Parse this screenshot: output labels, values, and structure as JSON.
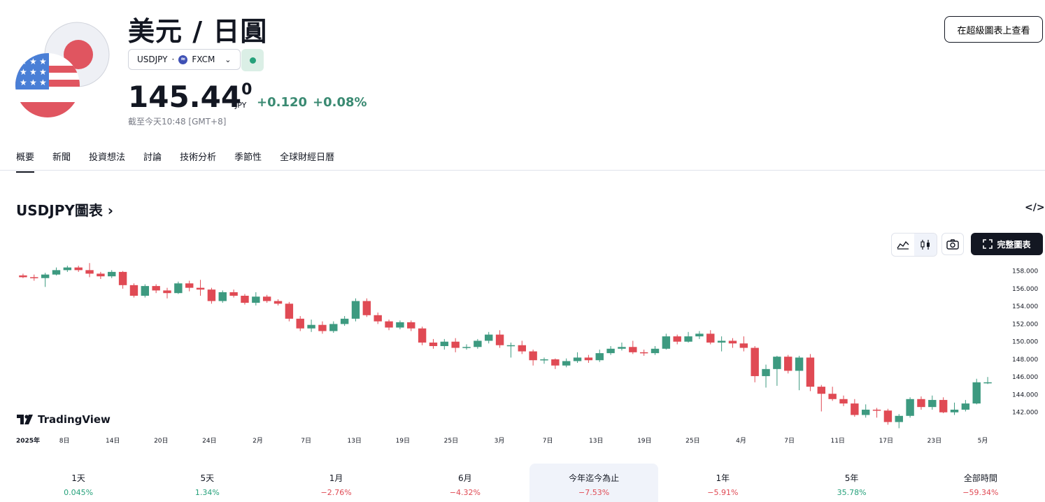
{
  "header": {
    "title": "美元 / 日圓",
    "symbol": "USDJPY",
    "separator": "·",
    "exchange": "FXCM",
    "price_main": "145.44",
    "price_sup": "0",
    "currency": "JPY",
    "change_abs": "+0.120",
    "change_pct": "+0.08%",
    "as_of": "截至今天10:48 [GMT+8]",
    "super_chart_button": "在超級圖表上查看",
    "status_color": "#26a17b"
  },
  "tabs": [
    "概要",
    "新聞",
    "投資想法",
    "討論",
    "技術分析",
    "季節性",
    "全球財經日曆"
  ],
  "chart_section": {
    "title": "USDJPY圖表",
    "full_chart_label": "完整圖表",
    "brand": "TradingView"
  },
  "chart_data": {
    "type": "candlestick",
    "up_color": "#3d9a80",
    "down_color": "#e04a54",
    "ylim": [
      140,
      159
    ],
    "y_ticks": [
      "158.000",
      "156.000",
      "154.000",
      "152.000",
      "150.000",
      "148.000",
      "146.000",
      "144.000",
      "142.000"
    ],
    "x_ticks": [
      "2025年",
      "8日",
      "14日",
      "20日",
      "24日",
      "2月",
      "7日",
      "13日",
      "19日",
      "25日",
      "3月",
      "7日",
      "13日",
      "19日",
      "25日",
      "4月",
      "7日",
      "11日",
      "17日",
      "23日",
      "5月"
    ],
    "candles": [
      [
        157.5,
        157.3,
        157.7,
        157.2
      ],
      [
        157.3,
        157.2,
        157.6,
        156.9
      ],
      [
        157.2,
        157.6,
        157.8,
        156.2
      ],
      [
        157.6,
        158.1,
        158.4,
        157.5
      ],
      [
        158.1,
        158.4,
        158.6,
        157.9
      ],
      [
        158.4,
        158.1,
        158.6,
        157.9
      ],
      [
        158.1,
        157.7,
        158.9,
        157.3
      ],
      [
        157.7,
        157.4,
        157.9,
        157.1
      ],
      [
        157.4,
        157.9,
        158.1,
        157.2
      ],
      [
        157.9,
        156.4,
        158.0,
        156.0
      ],
      [
        156.4,
        155.2,
        156.6,
        155.0
      ],
      [
        155.2,
        156.3,
        156.5,
        155.0
      ],
      [
        156.3,
        155.8,
        156.5,
        155.5
      ],
      [
        155.8,
        155.5,
        156.1,
        154.9
      ],
      [
        155.5,
        156.6,
        156.8,
        155.4
      ],
      [
        156.6,
        156.1,
        156.9,
        155.7
      ],
      [
        156.1,
        155.9,
        157.0,
        155.2
      ],
      [
        155.9,
        154.6,
        156.1,
        154.3
      ],
      [
        154.6,
        155.6,
        155.8,
        154.4
      ],
      [
        155.6,
        155.2,
        155.9,
        155.0
      ],
      [
        155.2,
        154.4,
        155.4,
        154.2
      ],
      [
        154.4,
        155.1,
        155.6,
        154.1
      ],
      [
        155.1,
        154.6,
        155.3,
        154.4
      ],
      [
        154.6,
        154.3,
        154.8,
        154.1
      ],
      [
        154.3,
        152.6,
        154.5,
        152.3
      ],
      [
        152.6,
        151.5,
        152.9,
        151.2
      ],
      [
        151.5,
        151.9,
        152.5,
        151.1
      ],
      [
        151.9,
        151.2,
        152.3,
        150.9
      ],
      [
        151.2,
        152.0,
        152.3,
        151.0
      ],
      [
        152.0,
        152.6,
        152.9,
        151.8
      ],
      [
        152.6,
        154.6,
        154.9,
        152.3
      ],
      [
        154.6,
        153.0,
        154.9,
        152.8
      ],
      [
        153.0,
        152.3,
        153.3,
        152.0
      ],
      [
        152.3,
        151.6,
        152.5,
        151.3
      ],
      [
        151.6,
        152.2,
        152.4,
        151.4
      ],
      [
        152.2,
        151.5,
        152.4,
        151.2
      ],
      [
        151.5,
        149.9,
        151.7,
        149.6
      ],
      [
        149.9,
        149.5,
        150.3,
        149.2
      ],
      [
        149.5,
        150.0,
        150.3,
        149.1
      ],
      [
        150.0,
        149.3,
        150.4,
        148.8
      ],
      [
        149.3,
        149.4,
        149.7,
        149.1
      ],
      [
        149.4,
        150.1,
        150.3,
        149.2
      ],
      [
        150.1,
        150.8,
        151.1,
        149.8
      ],
      [
        150.8,
        149.6,
        151.3,
        149.3
      ],
      [
        149.6,
        149.6,
        149.9,
        148.2
      ],
      [
        149.6,
        148.9,
        150.1,
        148.6
      ],
      [
        148.9,
        147.9,
        149.1,
        147.3
      ],
      [
        147.9,
        148.0,
        148.2,
        147.5
      ],
      [
        148.0,
        147.3,
        148.1,
        146.9
      ],
      [
        147.3,
        147.8,
        148.1,
        147.1
      ],
      [
        147.8,
        148.2,
        148.8,
        147.6
      ],
      [
        148.2,
        147.9,
        148.5,
        147.6
      ],
      [
        147.9,
        148.7,
        149.1,
        147.7
      ],
      [
        148.7,
        149.2,
        149.5,
        148.5
      ],
      [
        149.2,
        149.4,
        149.9,
        149.0
      ],
      [
        149.4,
        148.8,
        150.1,
        148.6
      ],
      [
        148.8,
        148.7,
        149.1,
        148.4
      ],
      [
        148.7,
        149.2,
        149.5,
        148.5
      ],
      [
        149.2,
        150.6,
        150.9,
        149.1
      ],
      [
        150.6,
        150.0,
        150.8,
        149.7
      ],
      [
        150.0,
        150.6,
        151.1,
        149.9
      ],
      [
        150.6,
        150.9,
        151.2,
        150.3
      ],
      [
        150.9,
        149.9,
        151.3,
        149.7
      ],
      [
        149.9,
        150.1,
        150.6,
        148.9
      ],
      [
        150.1,
        149.8,
        150.4,
        149.3
      ],
      [
        149.8,
        149.3,
        150.6,
        148.9
      ],
      [
        149.3,
        146.1,
        149.5,
        145.4
      ],
      [
        146.1,
        146.9,
        147.4,
        144.8
      ],
      [
        146.9,
        148.3,
        148.4,
        145.0
      ],
      [
        148.3,
        146.7,
        148.5,
        146.4
      ],
      [
        146.7,
        148.2,
        148.4,
        144.5
      ],
      [
        148.2,
        144.9,
        148.6,
        144.4
      ],
      [
        144.9,
        144.1,
        145.1,
        142.1
      ],
      [
        144.1,
        143.5,
        144.9,
        143.3
      ],
      [
        143.5,
        143.0,
        143.9,
        142.7
      ],
      [
        143.0,
        141.7,
        143.5,
        141.5
      ],
      [
        141.7,
        142.3,
        142.9,
        141.4
      ],
      [
        142.3,
        142.2,
        142.5,
        141.4
      ],
      [
        142.2,
        140.9,
        142.4,
        140.6
      ],
      [
        140.9,
        141.6,
        141.8,
        140.2
      ],
      [
        141.6,
        143.5,
        143.7,
        141.4
      ],
      [
        143.5,
        142.6,
        143.8,
        142.3
      ],
      [
        142.6,
        143.4,
        143.9,
        142.3
      ],
      [
        143.4,
        142.0,
        143.7,
        141.9
      ],
      [
        142.0,
        142.3,
        143.1,
        141.7
      ],
      [
        142.3,
        143.0,
        143.4,
        142.1
      ],
      [
        143.0,
        145.4,
        145.8,
        142.9
      ],
      [
        145.4,
        145.4,
        146.0,
        145.2
      ]
    ]
  },
  "periods": [
    {
      "label": "1天",
      "value": "0.045%",
      "dir": "pos"
    },
    {
      "label": "5天",
      "value": "1.34%",
      "dir": "pos"
    },
    {
      "label": "1月",
      "value": "−2.76%",
      "dir": "neg"
    },
    {
      "label": "6月",
      "value": "−4.32%",
      "dir": "neg"
    },
    {
      "label": "今年迄今為止",
      "value": "−7.53%",
      "dir": "neg",
      "selected": true
    },
    {
      "label": "1年",
      "value": "−5.91%",
      "dir": "neg"
    },
    {
      "label": "5年",
      "value": "35.78%",
      "dir": "pos"
    },
    {
      "label": "全部時間",
      "value": "−59.34%",
      "dir": "neg"
    }
  ]
}
